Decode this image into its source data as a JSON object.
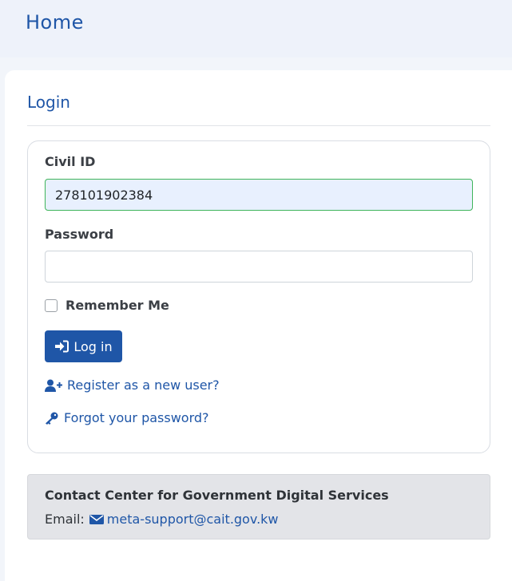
{
  "header": {
    "title": "Home"
  },
  "login": {
    "title": "Login",
    "civil_id_label": "Civil ID",
    "civil_id_value": "278101902384",
    "password_label": "Password",
    "password_value": "",
    "remember_label": "Remember Me",
    "remember_checked": false,
    "login_button": "Log in",
    "register_link": "Register as a new user?",
    "forgot_link": "Forgot your password?"
  },
  "contact": {
    "title": "Contact Center for Government Digital Services",
    "email_label": "Email:",
    "email": "meta-support@cait.gov.kw"
  },
  "colors": {
    "primary": "#1f56a7",
    "valid_border": "#3fb45a",
    "contact_bg": "#e3e4e8"
  },
  "icons": {
    "login_button": "sign-in-icon",
    "register": "user-plus-icon",
    "forgot": "key-icon",
    "email": "envelope-icon"
  }
}
